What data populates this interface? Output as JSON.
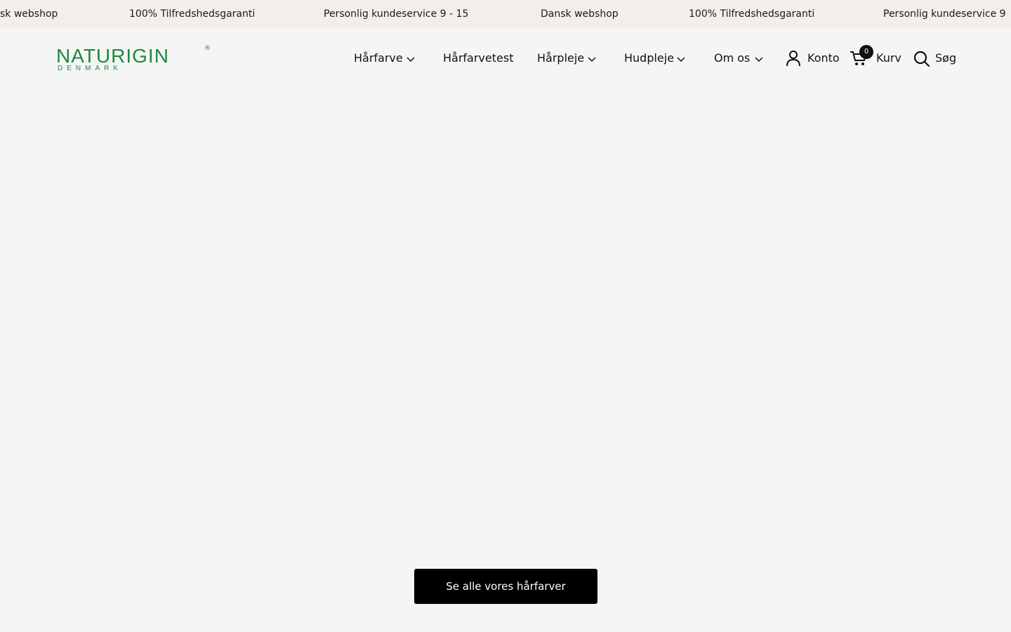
{
  "announcement": {
    "items": [
      "sk webshop",
      "100% Tilfredshedsgaranti",
      "Personlig kundeservice 9 - 15",
      "Dansk webshop",
      "100% Tilfredshedsgaranti",
      "Personlig kundeservice 9"
    ]
  },
  "brand": {
    "name": "NATURIGIN",
    "registered": "®",
    "subtitle": "DENMARK",
    "color": "#1e8a3a"
  },
  "nav": {
    "items": [
      {
        "label": "Hårfarve",
        "has_dropdown": true
      },
      {
        "label": "Hårfarvetest",
        "has_dropdown": false
      },
      {
        "label": "Hårpleje",
        "has_dropdown": true
      },
      {
        "label": "Hudpleje",
        "has_dropdown": true
      },
      {
        "label": "Om os",
        "has_dropdown": true
      }
    ]
  },
  "utility": {
    "account_label": "Konto",
    "cart_label": "Kurv",
    "cart_count": "0",
    "search_label": "Søg"
  },
  "hero": {
    "cta_label": "Se alle vores hårfarver"
  }
}
